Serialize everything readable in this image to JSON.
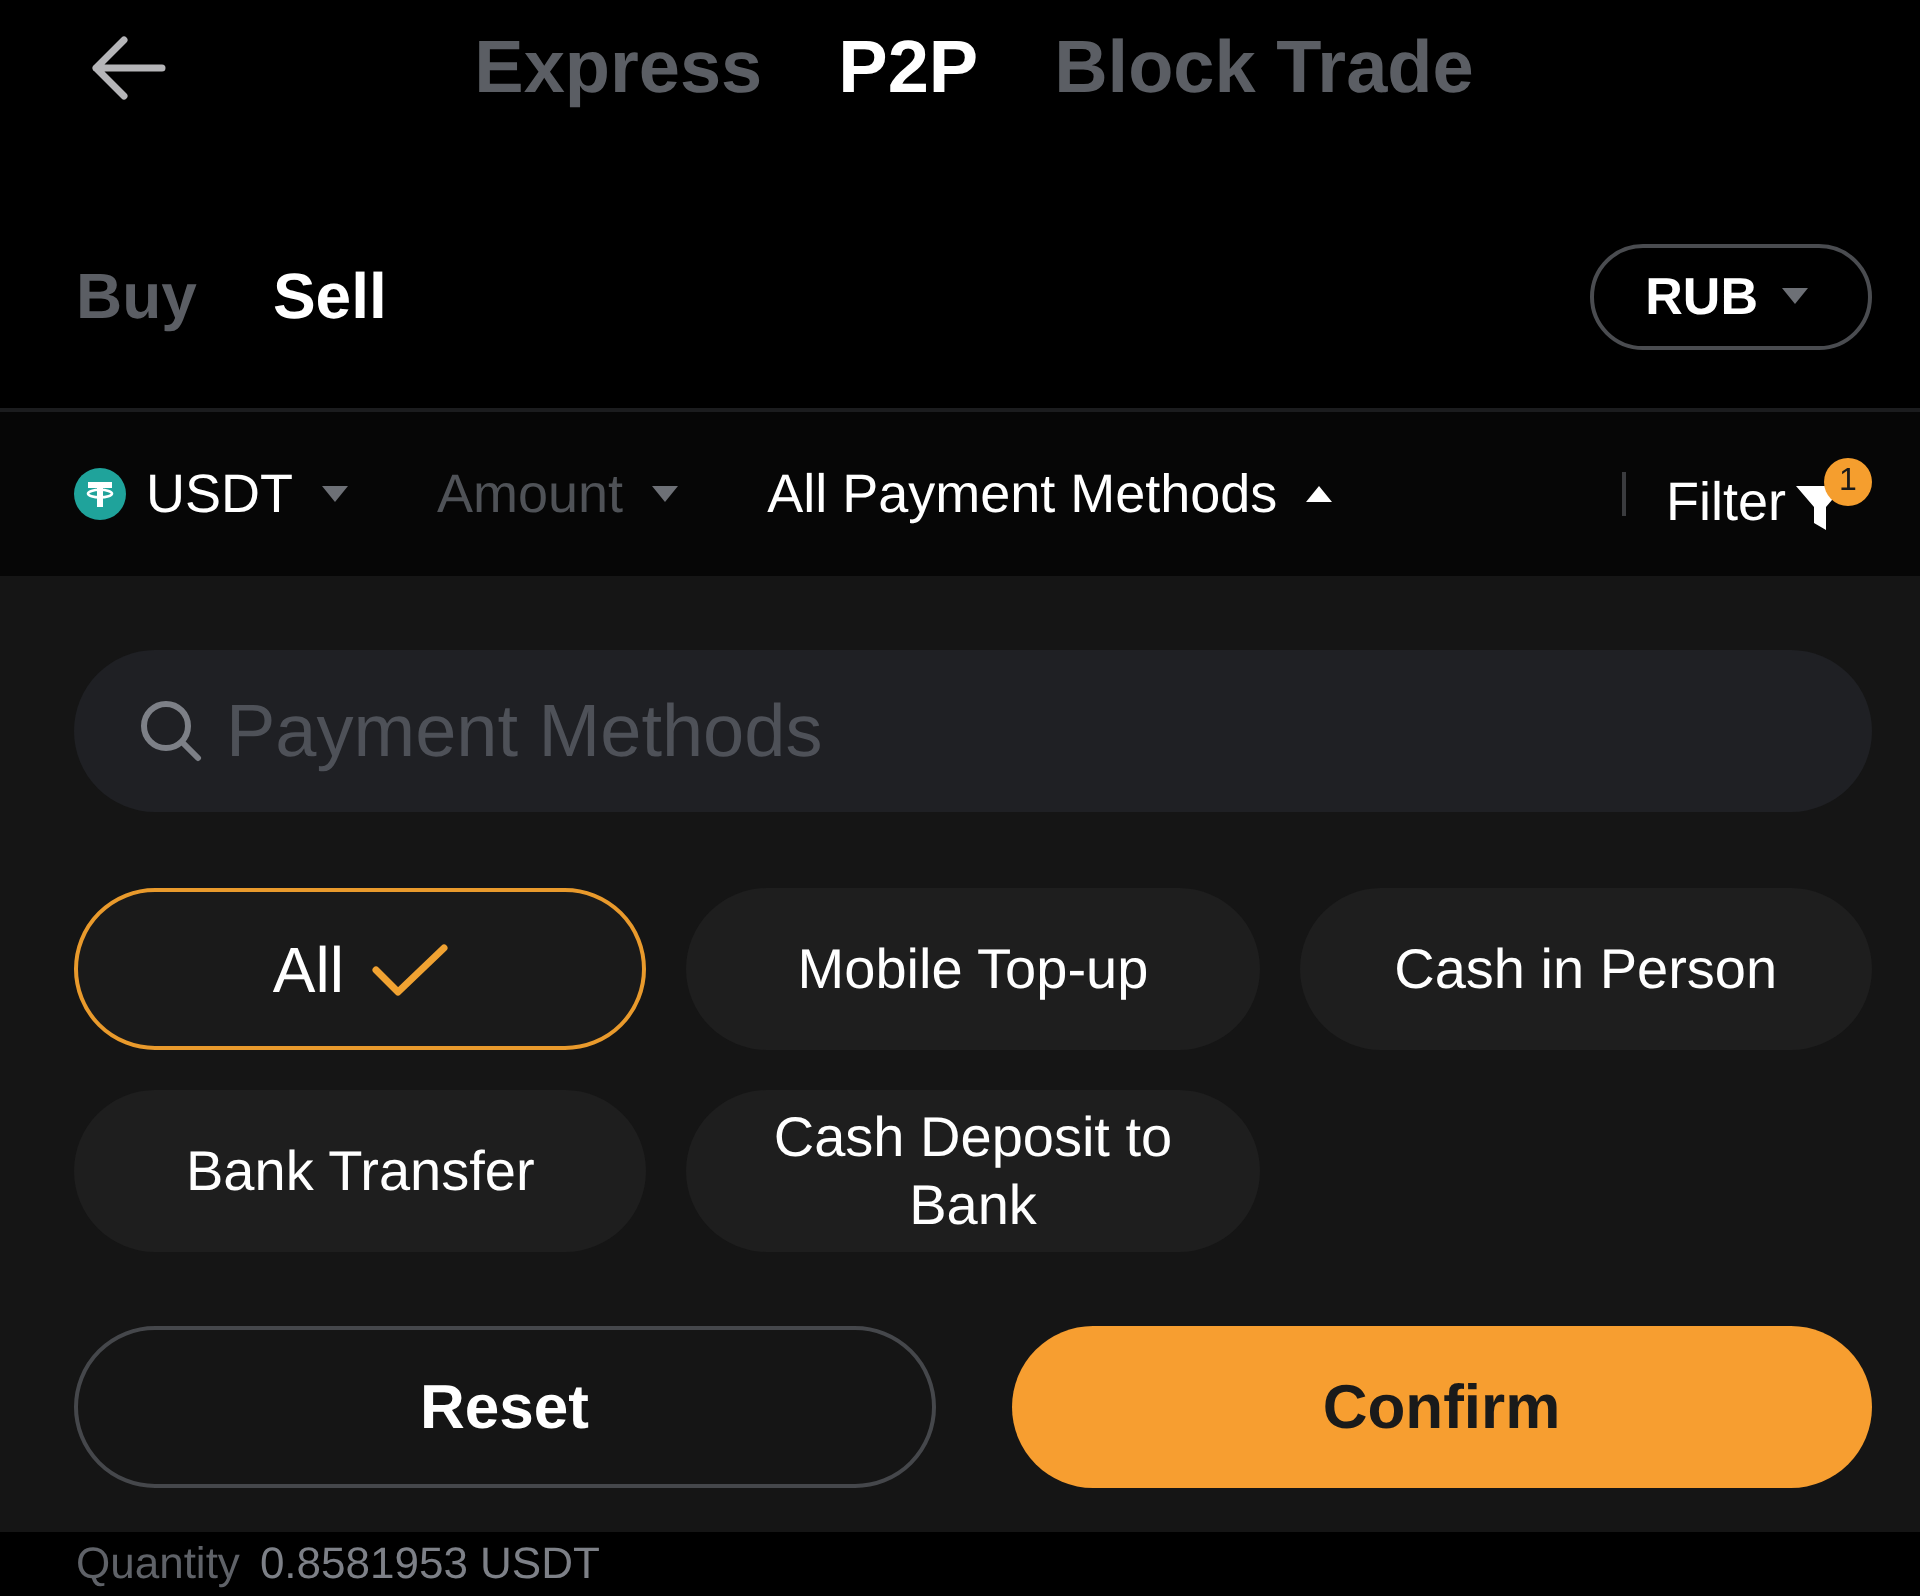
{
  "header": {
    "tabs": [
      {
        "label": "Express",
        "selected": false
      },
      {
        "label": "P2P",
        "selected": true
      },
      {
        "label": "Block Trade",
        "selected": false
      }
    ]
  },
  "trade_side": {
    "tabs": [
      {
        "label": "Buy",
        "selected": false
      },
      {
        "label": "Sell",
        "selected": true
      }
    ],
    "currency": {
      "label": "RUB"
    }
  },
  "filter_bar": {
    "dropdowns": [
      {
        "kind": "coin",
        "label": "USDT",
        "active": true,
        "expanded": false
      },
      {
        "kind": "plain",
        "label": "Amount",
        "active": false,
        "expanded": false
      },
      {
        "kind": "plain",
        "label": "All Payment Methods",
        "active": true,
        "expanded": true
      }
    ],
    "filter": {
      "label": "Filter",
      "badge": "1"
    }
  },
  "payment_panel": {
    "search": {
      "placeholder": "Payment Methods"
    },
    "methods": [
      {
        "label": "All",
        "selected": true
      },
      {
        "label": "Mobile Top-up",
        "selected": false
      },
      {
        "label": "Cash in Person",
        "selected": false
      },
      {
        "label": "Bank Transfer",
        "selected": false
      },
      {
        "label": "Cash Deposit to Bank",
        "selected": false
      }
    ],
    "buttons": [
      {
        "label": "Reset",
        "kind": "secondary"
      },
      {
        "label": "Confirm",
        "kind": "primary"
      }
    ]
  },
  "listing_peek": {
    "label": "Quantity",
    "value": "0.8581953 USDT"
  }
}
